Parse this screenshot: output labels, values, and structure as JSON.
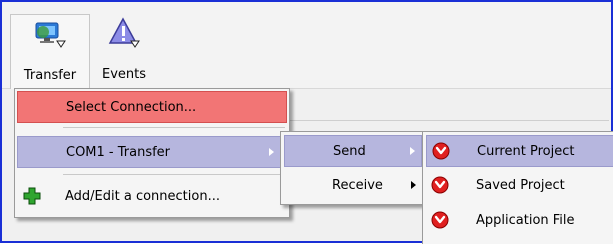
{
  "toolbar": {
    "transfer_label": "Transfer",
    "events_label": "Events"
  },
  "menu1": {
    "select_connection": "Select Connection...",
    "com1_transfer": "COM1 - Transfer",
    "add_edit": "Add/Edit a connection..."
  },
  "menu2": {
    "send": "Send",
    "receive": "Receive"
  },
  "menu3": {
    "current_project": "Current Project",
    "saved_project": "Saved Project",
    "application_file": "Application File"
  },
  "colors": {
    "highlight_red": "#f27575",
    "highlight_blue": "#b6b6de",
    "frame_border": "#1a2fd6"
  }
}
